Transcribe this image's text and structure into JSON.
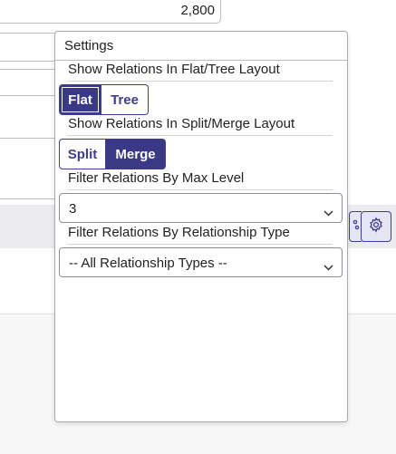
{
  "background": {
    "top_value": "2,800",
    "settings_button_icon": "gear-icon",
    "partial_icon": "link-icon"
  },
  "settings": {
    "title": "Settings",
    "flat_tree": {
      "label": "Show Relations In Flat/Tree Layout",
      "options": [
        "Flat",
        "Tree"
      ],
      "selected": "Flat"
    },
    "split_merge": {
      "label": "Show Relations In Split/Merge Layout",
      "options": [
        "Split",
        "Merge"
      ],
      "selected": "Merge"
    },
    "max_level": {
      "label": "Filter Relations By Max Level",
      "value": "3"
    },
    "relationship_type": {
      "label": "Filter Relations By Relationship Type",
      "value": "-- All Relationship Types --"
    }
  },
  "colors": {
    "accent": "#3a3985",
    "accent_border": "#3f3d8f"
  }
}
